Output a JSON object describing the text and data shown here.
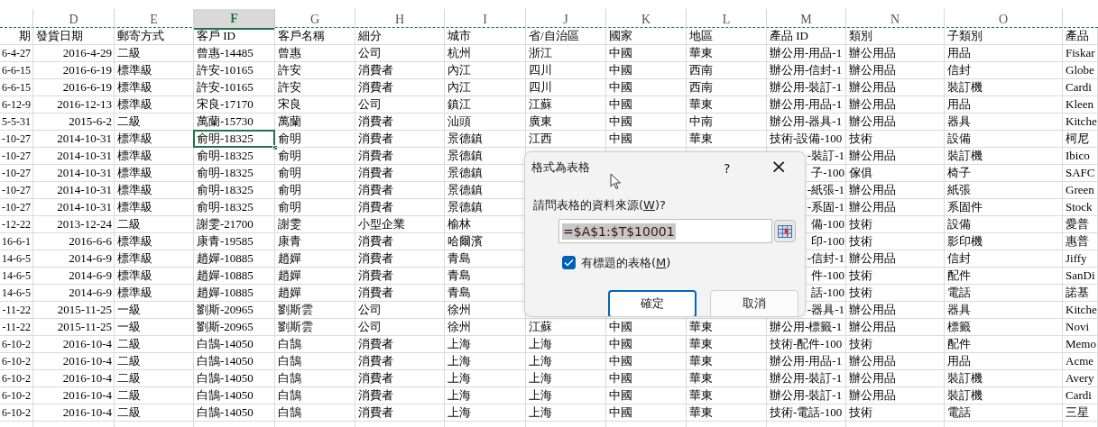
{
  "column_headers": [
    {
      "letter": "D",
      "selected": false
    },
    {
      "letter": "E",
      "selected": false
    },
    {
      "letter": "F",
      "selected": true
    },
    {
      "letter": "G",
      "selected": false
    },
    {
      "letter": "H",
      "selected": false
    },
    {
      "letter": "I",
      "selected": false
    },
    {
      "letter": "J",
      "selected": false
    },
    {
      "letter": "K",
      "selected": false
    },
    {
      "letter": "L",
      "selected": false
    },
    {
      "letter": "M",
      "selected": false
    },
    {
      "letter": "N",
      "selected": false
    },
    {
      "letter": "O",
      "selected": false
    }
  ],
  "header_row": {
    "c": "期",
    "d": "發貨日期",
    "e": "郵寄方式",
    "f": "客戶 ID",
    "g": "客戶名稱",
    "h": "細分",
    "i": "城市",
    "j": "省/自治區",
    "k": "國家",
    "l": "地區",
    "m": "產品 ID",
    "n": "類別",
    "o": "子類別",
    "p": "產品"
  },
  "rows": [
    {
      "c": "6-4-27",
      "d": "2016-4-29",
      "e": "二級",
      "f": "曾惠-14485",
      "g": "曾惠",
      "h": "公司",
      "i": "杭州",
      "j": "浙江",
      "k": "中國",
      "l": "華東",
      "m": "辦公用-用品-1",
      "n": "辦公用品",
      "o": "用品",
      "p": "Fiskar"
    },
    {
      "c": "6-6-15",
      "d": "2016-6-19",
      "e": "標準級",
      "f": "許安-10165",
      "g": "許安",
      "h": "消費者",
      "i": "內江",
      "j": "四川",
      "k": "中國",
      "l": "西南",
      "m": "辦公用-信封-1",
      "n": "辦公用品",
      "o": "信封",
      "p": "Globe"
    },
    {
      "c": "6-6-15",
      "d": "2016-6-19",
      "e": "標準級",
      "f": "許安-10165",
      "g": "許安",
      "h": "消費者",
      "i": "內江",
      "j": "四川",
      "k": "中國",
      "l": "西南",
      "m": "辦公用-裝訂-1",
      "n": "辦公用品",
      "o": "裝訂機",
      "p": "Cardi"
    },
    {
      "c": "6-12-9",
      "d": "2016-12-13",
      "e": "標準級",
      "f": "宋良-17170",
      "g": "宋良",
      "h": "公司",
      "i": "鎮江",
      "j": "江蘇",
      "k": "中國",
      "l": "華東",
      "m": "辦公用-用品-1",
      "n": "辦公用品",
      "o": "用品",
      "p": "Kleen"
    },
    {
      "c": "5-5-31",
      "d": "2015-6-2",
      "e": "二級",
      "f": "萬蘭-15730",
      "g": "萬蘭",
      "h": "消費者",
      "i": "汕頭",
      "j": "廣東",
      "k": "中國",
      "l": "中南",
      "m": "辦公用-器具-1",
      "n": "辦公用品",
      "o": "器具",
      "p": "Kitche"
    },
    {
      "c": "-10-27",
      "d": "2014-10-31",
      "e": "標準級",
      "f": "俞明-18325",
      "g": "俞明",
      "h": "消費者",
      "i": "景德鎮",
      "j": "江西",
      "k": "中國",
      "l": "華東",
      "m": "技術-設備-100",
      "n": "技術",
      "o": "設備",
      "p": "柯尼",
      "active": true
    },
    {
      "c": "-10-27",
      "d": "2014-10-31",
      "e": "標準級",
      "f": "俞明-18325",
      "g": "俞明",
      "h": "消費者",
      "i": "景德鎮",
      "m": "-裝訂-1",
      "n": "辦公用品",
      "o": "裝訂機",
      "p": "Ibico"
    },
    {
      "c": "-10-27",
      "d": "2014-10-31",
      "e": "標準級",
      "f": "俞明-18325",
      "g": "俞明",
      "h": "消費者",
      "i": "景德鎮",
      "m": "子-100",
      "n": "傢俱",
      "o": "椅子",
      "p": "SAFC"
    },
    {
      "c": "-10-27",
      "d": "2014-10-31",
      "e": "標準級",
      "f": "俞明-18325",
      "g": "俞明",
      "h": "消費者",
      "i": "景德鎮",
      "m": "-紙張-1",
      "n": "辦公用品",
      "o": "紙張",
      "p": "Green"
    },
    {
      "c": "-10-27",
      "d": "2014-10-31",
      "e": "標準級",
      "f": "俞明-18325",
      "g": "俞明",
      "h": "消費者",
      "i": "景德鎮",
      "m": "-系固-1",
      "n": "辦公用品",
      "o": "系固件",
      "p": "Stock"
    },
    {
      "c": "-12-22",
      "d": "2013-12-24",
      "e": "二級",
      "f": "謝雯-21700",
      "g": "謝雯",
      "h": "小型企業",
      "i": "榆林",
      "m": "備-100",
      "n": "技術",
      "o": "設備",
      "p": "愛普"
    },
    {
      "c": "16-6-1",
      "d": "2016-6-6",
      "e": "標準級",
      "f": "康青-19585",
      "g": "康青",
      "h": "消費者",
      "i": "哈爾濱",
      "m": "印-100",
      "n": "技術",
      "o": "影印機",
      "p": "惠普"
    },
    {
      "c": "14-6-5",
      "d": "2014-6-9",
      "e": "標準級",
      "f": "趙嬋-10885",
      "g": "趙嬋",
      "h": "消費者",
      "i": "青島",
      "m": "-信封-1",
      "n": "辦公用品",
      "o": "信封",
      "p": "Jiffy"
    },
    {
      "c": "14-6-5",
      "d": "2014-6-9",
      "e": "標準級",
      "f": "趙嬋-10885",
      "g": "趙嬋",
      "h": "消費者",
      "i": "青島",
      "m": "件-100",
      "n": "技術",
      "o": "配件",
      "p": "SanDi"
    },
    {
      "c": "14-6-5",
      "d": "2014-6-9",
      "e": "標準級",
      "f": "趙嬋-10885",
      "g": "趙嬋",
      "h": "消費者",
      "i": "青島",
      "m": "話-100",
      "n": "技術",
      "o": "電話",
      "p": "諾基"
    },
    {
      "c": "-11-22",
      "d": "2015-11-25",
      "e": "一級",
      "f": "劉斯-20965",
      "g": "劉斯雲",
      "h": "公司",
      "i": "徐州",
      "m": "-器具-1",
      "n": "辦公用品",
      "o": "器具",
      "p": "Kitche"
    },
    {
      "c": "-11-22",
      "d": "2015-11-25",
      "e": "一級",
      "f": "劉斯-20965",
      "g": "劉斯雲",
      "h": "公司",
      "i": "徐州",
      "j": "江蘇",
      "k": "中國",
      "l": "華東",
      "m": "辦公用-標籤-1",
      "n": "辦公用品",
      "o": "標籤",
      "p": "Novi"
    },
    {
      "c": "6-10-2",
      "d": "2016-10-4",
      "e": "二級",
      "f": "白鵠-14050",
      "g": "白鵠",
      "h": "消費者",
      "i": "上海",
      "j": "上海",
      "k": "中國",
      "l": "華東",
      "m": "技術-配件-100",
      "n": "技術",
      "o": "配件",
      "p": "Memo"
    },
    {
      "c": "6-10-2",
      "d": "2016-10-4",
      "e": "二級",
      "f": "白鵠-14050",
      "g": "白鵠",
      "h": "消費者",
      "i": "上海",
      "j": "上海",
      "k": "中國",
      "l": "華東",
      "m": "辦公用-用品-1",
      "n": "辦公用品",
      "o": "用品",
      "p": "Acme"
    },
    {
      "c": "6-10-2",
      "d": "2016-10-4",
      "e": "二級",
      "f": "白鵠-14050",
      "g": "白鵠",
      "h": "消費者",
      "i": "上海",
      "j": "上海",
      "k": "中國",
      "l": "華東",
      "m": "辦公用-裝訂-1",
      "n": "辦公用品",
      "o": "裝訂機",
      "p": "Avery"
    },
    {
      "c": "6-10-2",
      "d": "2016-10-4",
      "e": "二級",
      "f": "白鵠-14050",
      "g": "白鵠",
      "h": "消費者",
      "i": "上海",
      "j": "上海",
      "k": "中國",
      "l": "華東",
      "m": "辦公用-裝訂-1",
      "n": "辦公用品",
      "o": "裝訂機",
      "p": "Cardi"
    },
    {
      "c": "6-10-2",
      "d": "2016-10-4",
      "e": "二級",
      "f": "白鵠-14050",
      "g": "白鵠",
      "h": "消費者",
      "i": "上海",
      "j": "上海",
      "k": "中國",
      "l": "華東",
      "m": "技術-電話-100",
      "n": "技術",
      "o": "電話",
      "p": "三星"
    }
  ],
  "dialog": {
    "title": "格式為表格",
    "help": "?",
    "close": "×",
    "source_label": {
      "before": "請問表格的資料來源(",
      "access_key": "W",
      "after": ")?"
    },
    "source_field": {
      "value": "=$A$1:$T$10001"
    },
    "header_checkbox": {
      "before": "有標題的表格(",
      "access_key": "M",
      "after": ")",
      "checked": true
    },
    "buttons": [
      {
        "label": "確定",
        "default": true
      },
      {
        "label": "取消",
        "default": false
      }
    ]
  }
}
